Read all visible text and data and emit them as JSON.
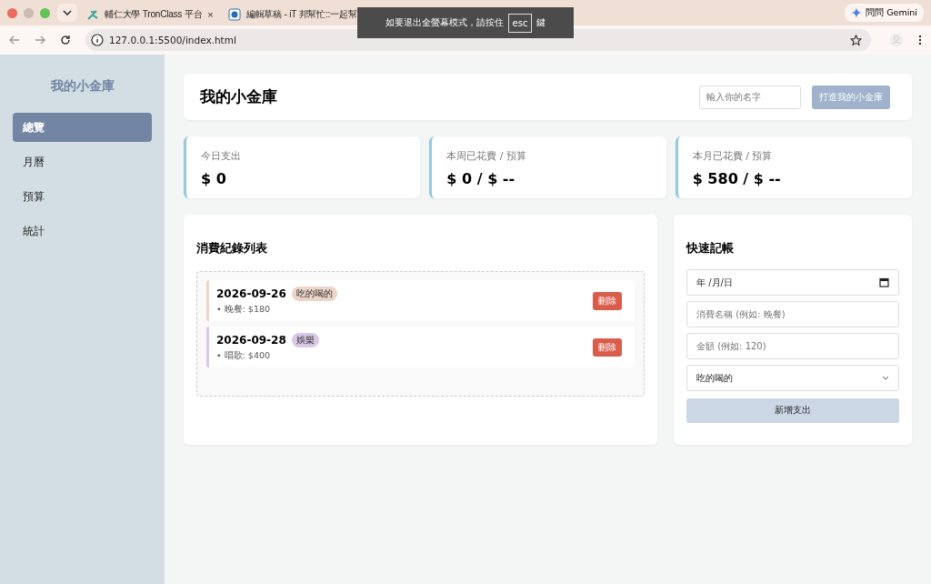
{
  "browser": {
    "tabs": [
      {
        "title": "輔仁大學 TronClass 平台",
        "selected": false,
        "close": "×"
      },
      {
        "title": "編輯草稿 - iT 邦幫忙::一起幫",
        "selected": false
      }
    ],
    "gemini": "問問 Gemini",
    "url": "127.0.0.1:5500/index.html",
    "fullscreen_notice": {
      "before": "如要退出全螢幕模式，請按住",
      "key": "esc",
      "after": "鍵"
    }
  },
  "sidebar": {
    "title": "我的小金庫",
    "items": [
      {
        "label": "總覽",
        "selected": true
      },
      {
        "label": "月曆",
        "selected": false
      },
      {
        "label": "預算",
        "selected": false
      },
      {
        "label": "統計",
        "selected": false
      }
    ]
  },
  "header": {
    "title": "我的小金庫",
    "name_placeholder": "輸入你的名字",
    "button": "打造我的小金庫"
  },
  "stats": [
    {
      "label": "今日支出",
      "value": "$ 0"
    },
    {
      "label": "本周已花費 / 預算",
      "value": "$ 0 / $ --"
    },
    {
      "label": "本月已花費 / 預算",
      "value": "$ 580 / $ --"
    }
  ],
  "records": {
    "title": "消費紀錄列表",
    "items": [
      {
        "date": "2026-09-26",
        "tag": "吃的喝的",
        "color": "#ebd4c8",
        "detail": "• 晚餐: $180",
        "delete": "刪除"
      },
      {
        "date": "2026-09-28",
        "tag": "娛樂",
        "color": "#d9c9e6",
        "detail": "• 唱歌: $400",
        "delete": "刪除"
      }
    ]
  },
  "quick_add": {
    "title": "快速記帳",
    "date_value": "年 /月/日",
    "name_placeholder": "消費名稱 (例如: 晚餐)",
    "amount_placeholder": "金額 (例如: 120)",
    "category": "吃的喝的",
    "button": "新增支出"
  }
}
